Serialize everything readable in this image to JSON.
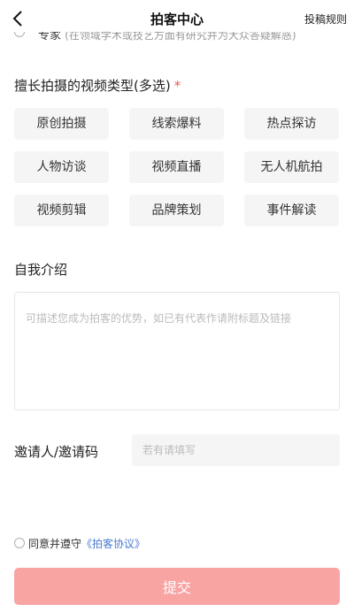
{
  "header": {
    "title": "拍客中心",
    "rules_link": "投稿规则"
  },
  "expert_option": {
    "label": "专家",
    "description": "(在领域学术或技艺方面有研究并为大众答疑解惑)"
  },
  "video_types": {
    "title": "擅长拍摄的视频类型(多选)",
    "required_mark": "*",
    "tags": [
      "原创拍摄",
      "线索爆料",
      "热点探访",
      "人物访谈",
      "视频直播",
      "无人机航拍",
      "视频剪辑",
      "品牌策划",
      "事件解读"
    ]
  },
  "intro": {
    "title": "自我介绍",
    "placeholder": "可描述您成为拍客的优势，如已有代表作请附标题及链接"
  },
  "invite": {
    "label": "邀请人/邀请码",
    "placeholder": "若有请填写"
  },
  "agreement": {
    "text": "同意并遵守",
    "link": "《拍客协议》"
  },
  "submit_label": "提交",
  "colors": {
    "accent": "#f25a4a",
    "submit_bg": "#f7a4a3",
    "link": "#4a7bd0"
  }
}
